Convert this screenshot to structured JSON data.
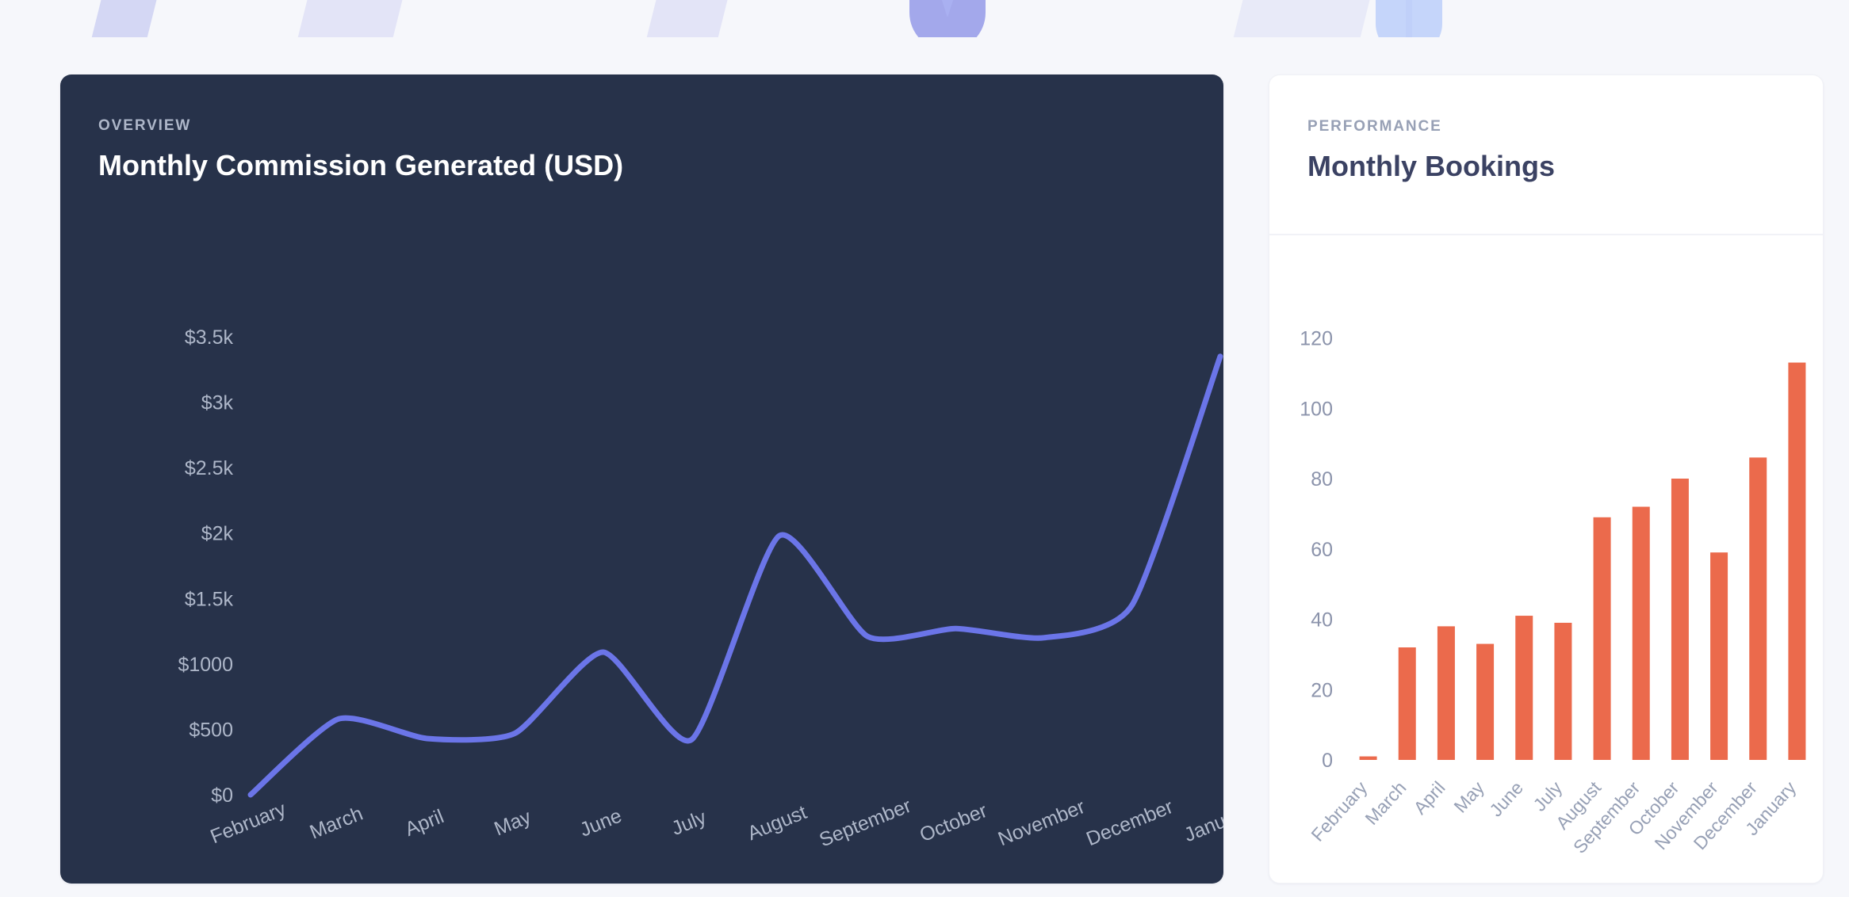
{
  "banner": {
    "accent_start": "#4f52ea",
    "accent_end": "#5a8df7",
    "decoration_1": "shield-shape",
    "decoration_2": "badge-shape"
  },
  "page": {
    "background": "#f6f7fb"
  },
  "cards": {
    "overview": {
      "eyebrow": "OVERVIEW",
      "title": "Monthly Commission Generated (USD)",
      "background": "#27324a",
      "accent": "#6b75e8"
    },
    "performance": {
      "eyebrow": "PERFORMANCE",
      "title": "Monthly Bookings",
      "background": "#ffffff",
      "accent": "#eb6a4c"
    }
  },
  "chart_data": [
    {
      "type": "line",
      "title": "Monthly Commission Generated (USD)",
      "xlabel": "",
      "ylabel": "",
      "categories": [
        "February",
        "March",
        "April",
        "May",
        "June",
        "July",
        "August",
        "September",
        "October",
        "November",
        "December",
        "January"
      ],
      "x_tick_labels": [
        "February",
        "March",
        "April",
        "May",
        "June",
        "July",
        "August",
        "September",
        "October",
        "November",
        "December",
        "January"
      ],
      "y_tick_labels": [
        "$0",
        "$500",
        "$1000",
        "$1.5k",
        "$2k",
        "$2.5k",
        "$3k",
        "$3.5k"
      ],
      "y_tick_values": [
        0,
        500,
        1000,
        1500,
        2000,
        2500,
        3000,
        3500
      ],
      "ylim": [
        0,
        3500
      ],
      "values": [
        0,
        580,
        430,
        470,
        1090,
        420,
        1980,
        1210,
        1270,
        1200,
        1450,
        3350
      ],
      "series": [
        {
          "name": "Commission",
          "color": "#6b75e8",
          "values": [
            0,
            580,
            430,
            470,
            1090,
            420,
            1980,
            1210,
            1270,
            1200,
            1450,
            3350
          ]
        }
      ],
      "grid": false,
      "legend": "none",
      "smoothing": "spline",
      "line_width": 7
    },
    {
      "type": "bar",
      "title": "Monthly Bookings",
      "xlabel": "",
      "ylabel": "",
      "categories": [
        "February",
        "March",
        "April",
        "May",
        "June",
        "July",
        "August",
        "September",
        "October",
        "November",
        "December",
        "January"
      ],
      "x_tick_labels": [
        "February",
        "March",
        "April",
        "May",
        "June",
        "July",
        "August",
        "September",
        "October",
        "November",
        "December",
        "January"
      ],
      "y_tick_labels": [
        "0",
        "20",
        "40",
        "60",
        "80",
        "100",
        "120"
      ],
      "y_tick_values": [
        0,
        20,
        40,
        60,
        80,
        100,
        120
      ],
      "ylim": [
        0,
        128
      ],
      "values": [
        1,
        32,
        38,
        33,
        41,
        39,
        69,
        72,
        80,
        59,
        86,
        113
      ],
      "series": [
        {
          "name": "Bookings",
          "color": "#eb6a4c",
          "values": [
            1,
            32,
            38,
            33,
            41,
            39,
            69,
            72,
            80,
            59,
            86,
            113
          ]
        }
      ],
      "grid": false,
      "legend": "none"
    }
  ]
}
